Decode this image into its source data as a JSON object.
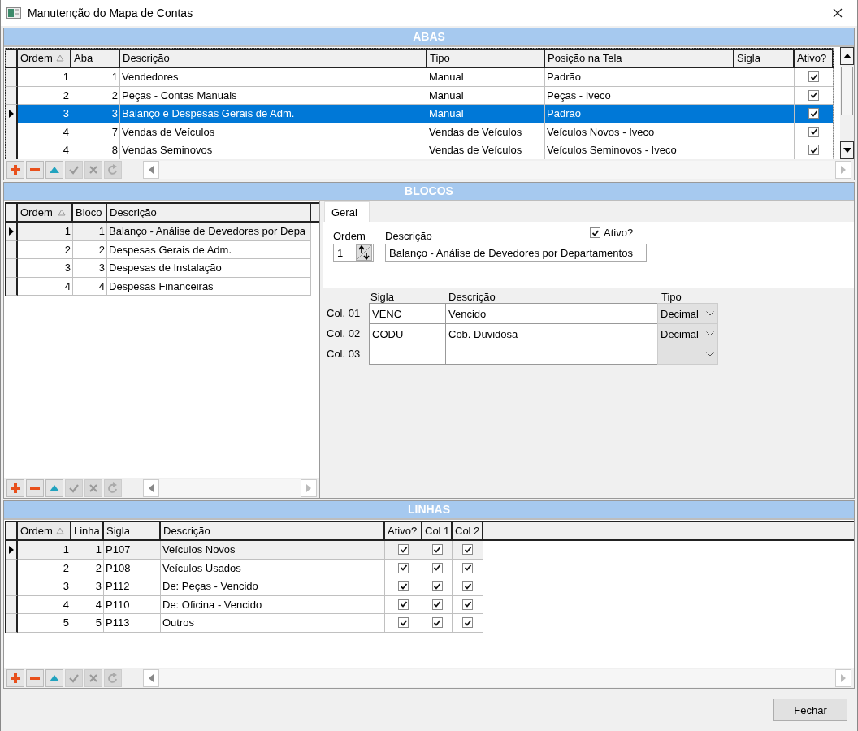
{
  "window": {
    "title": "Manutenção do Mapa de Contas"
  },
  "abas": {
    "title": "ABAS",
    "focused": true,
    "columns": [
      {
        "label": "Ordem",
        "sorted": true
      },
      {
        "label": "Aba",
        "sorted": false
      },
      {
        "label": "Descrição",
        "sorted": false
      },
      {
        "label": "Tipo",
        "sorted": false
      },
      {
        "label": "Posição na Tela",
        "sorted": false
      },
      {
        "label": "Sigla",
        "sorted": false
      },
      {
        "label": "Ativo?",
        "sorted": false
      }
    ],
    "rows": [
      {
        "ordem": "1",
        "aba": "1",
        "descricao": "Vendedores",
        "tipo": "Manual",
        "posicao": "Padrão",
        "ativo": true,
        "selected": false
      },
      {
        "ordem": "2",
        "aba": "2",
        "descricao": "Peças - Contas Manuais",
        "tipo": "Manual",
        "posicao": "Peças - Iveco",
        "ativo": true,
        "selected": false
      },
      {
        "ordem": "3",
        "aba": "3",
        "descricao": "Balanço e Despesas Gerais de Adm.",
        "tipo": "Manual",
        "posicao": "Padrão",
        "ativo": true,
        "selected": true
      },
      {
        "ordem": "4",
        "aba": "7",
        "descricao": "Vendas de Veículos",
        "tipo": "Vendas de Veículos",
        "posicao": "Veículos Novos - Iveco",
        "ativo": true,
        "selected": false
      },
      {
        "ordem": "4",
        "aba": "8",
        "descricao": "Vendas Seminovos",
        "tipo": "Vendas de Veículos",
        "posicao": "Veículos Seminovos - Iveco",
        "ativo": true,
        "selected": false
      }
    ],
    "toolbar": [
      {
        "kind": "add",
        "disabled": false
      },
      {
        "kind": "remove",
        "disabled": false
      },
      {
        "kind": "up",
        "disabled": false
      },
      {
        "kind": "post",
        "disabled": true
      },
      {
        "kind": "cancel",
        "disabled": true
      },
      {
        "kind": "refresh",
        "disabled": true
      }
    ]
  },
  "blocos": {
    "title": "BLOCOS",
    "focused": false,
    "columns": [
      {
        "label": "Ordem",
        "sorted": true
      },
      {
        "label": "Bloco",
        "sorted": false
      },
      {
        "label": "Descrição",
        "sorted": false
      }
    ],
    "rows": [
      {
        "ordem": "1",
        "bloco": "1",
        "descricao": "Balanço - Análise de Devedores por Depa",
        "selected": true
      },
      {
        "ordem": "2",
        "bloco": "2",
        "descricao": "Despesas Gerais de Adm.",
        "selected": false
      },
      {
        "ordem": "3",
        "bloco": "3",
        "descricao": "Despesas de Instalação",
        "selected": false
      },
      {
        "ordem": "4",
        "bloco": "4",
        "descricao": "Despesas Financeiras",
        "selected": false
      }
    ],
    "toolbar": [
      {
        "kind": "add",
        "disabled": false
      },
      {
        "kind": "remove",
        "disabled": false
      },
      {
        "kind": "up",
        "disabled": false
      },
      {
        "kind": "post",
        "disabled": true
      },
      {
        "kind": "cancel",
        "disabled": true
      },
      {
        "kind": "refresh",
        "disabled": true
      }
    ],
    "detail": {
      "tabs": [
        {
          "label": "Geral",
          "selected": true
        }
      ],
      "ordem": {
        "label": "Ordem",
        "value": "1"
      },
      "descricao": {
        "label": "Descrição",
        "value": "Balanço - Análise de Devedores por Departamentos"
      },
      "ativo": {
        "label": "Ativo?",
        "checked": true
      },
      "col_headers": [
        "Sigla",
        "Descrição",
        "Tipo"
      ],
      "cols": [
        {
          "label": "Col. 01",
          "sigla": "VENC",
          "descricao": "Vencido",
          "tipo": "Decimal"
        },
        {
          "label": "Col. 02",
          "sigla": "CODU",
          "descricao": "Cob. Duvidosa",
          "tipo": "Decimal"
        },
        {
          "label": "Col. 03"
        }
      ]
    }
  },
  "linhas": {
    "title": "LINHAS",
    "focused": false,
    "columns": [
      {
        "label": "Ordem",
        "sorted": true
      },
      {
        "label": "Linha",
        "sorted": false
      },
      {
        "label": "Sigla",
        "sorted": false
      },
      {
        "label": "Descrição",
        "sorted": false
      },
      {
        "label": "Ativo?",
        "sorted": false
      },
      {
        "label": "Col 1",
        "sorted": false
      },
      {
        "label": "Col 2",
        "sorted": false
      }
    ],
    "rows": [
      {
        "ordem": "1",
        "linha": "1",
        "sigla": "P107",
        "descricao": "Veículos Novos",
        "ativo": true,
        "col1": true,
        "col2": true,
        "selected": true
      },
      {
        "ordem": "2",
        "linha": "2",
        "sigla": "P108",
        "descricao": "Veículos Usados",
        "ativo": true,
        "col1": true,
        "col2": true,
        "selected": false
      },
      {
        "ordem": "3",
        "linha": "3",
        "sigla": "P112",
        "descricao": "De: Peças - Vencido",
        "ativo": true,
        "col1": true,
        "col2": true,
        "selected": false
      },
      {
        "ordem": "4",
        "linha": "4",
        "sigla": "P110",
        "descricao": "De: Oficina - Vencido",
        "ativo": true,
        "col1": true,
        "col2": true,
        "selected": false
      },
      {
        "ordem": "5",
        "linha": "5",
        "sigla": "P113",
        "descricao": "Outros",
        "ativo": true,
        "col1": true,
        "col2": true,
        "selected": false
      }
    ],
    "toolbar": [
      {
        "kind": "add",
        "disabled": false
      },
      {
        "kind": "remove",
        "disabled": false
      },
      {
        "kind": "up",
        "disabled": false
      },
      {
        "kind": "post",
        "disabled": true
      },
      {
        "kind": "cancel",
        "disabled": true
      },
      {
        "kind": "refresh",
        "disabled": true
      }
    ]
  },
  "footer": {
    "close_button": "Fechar"
  }
}
